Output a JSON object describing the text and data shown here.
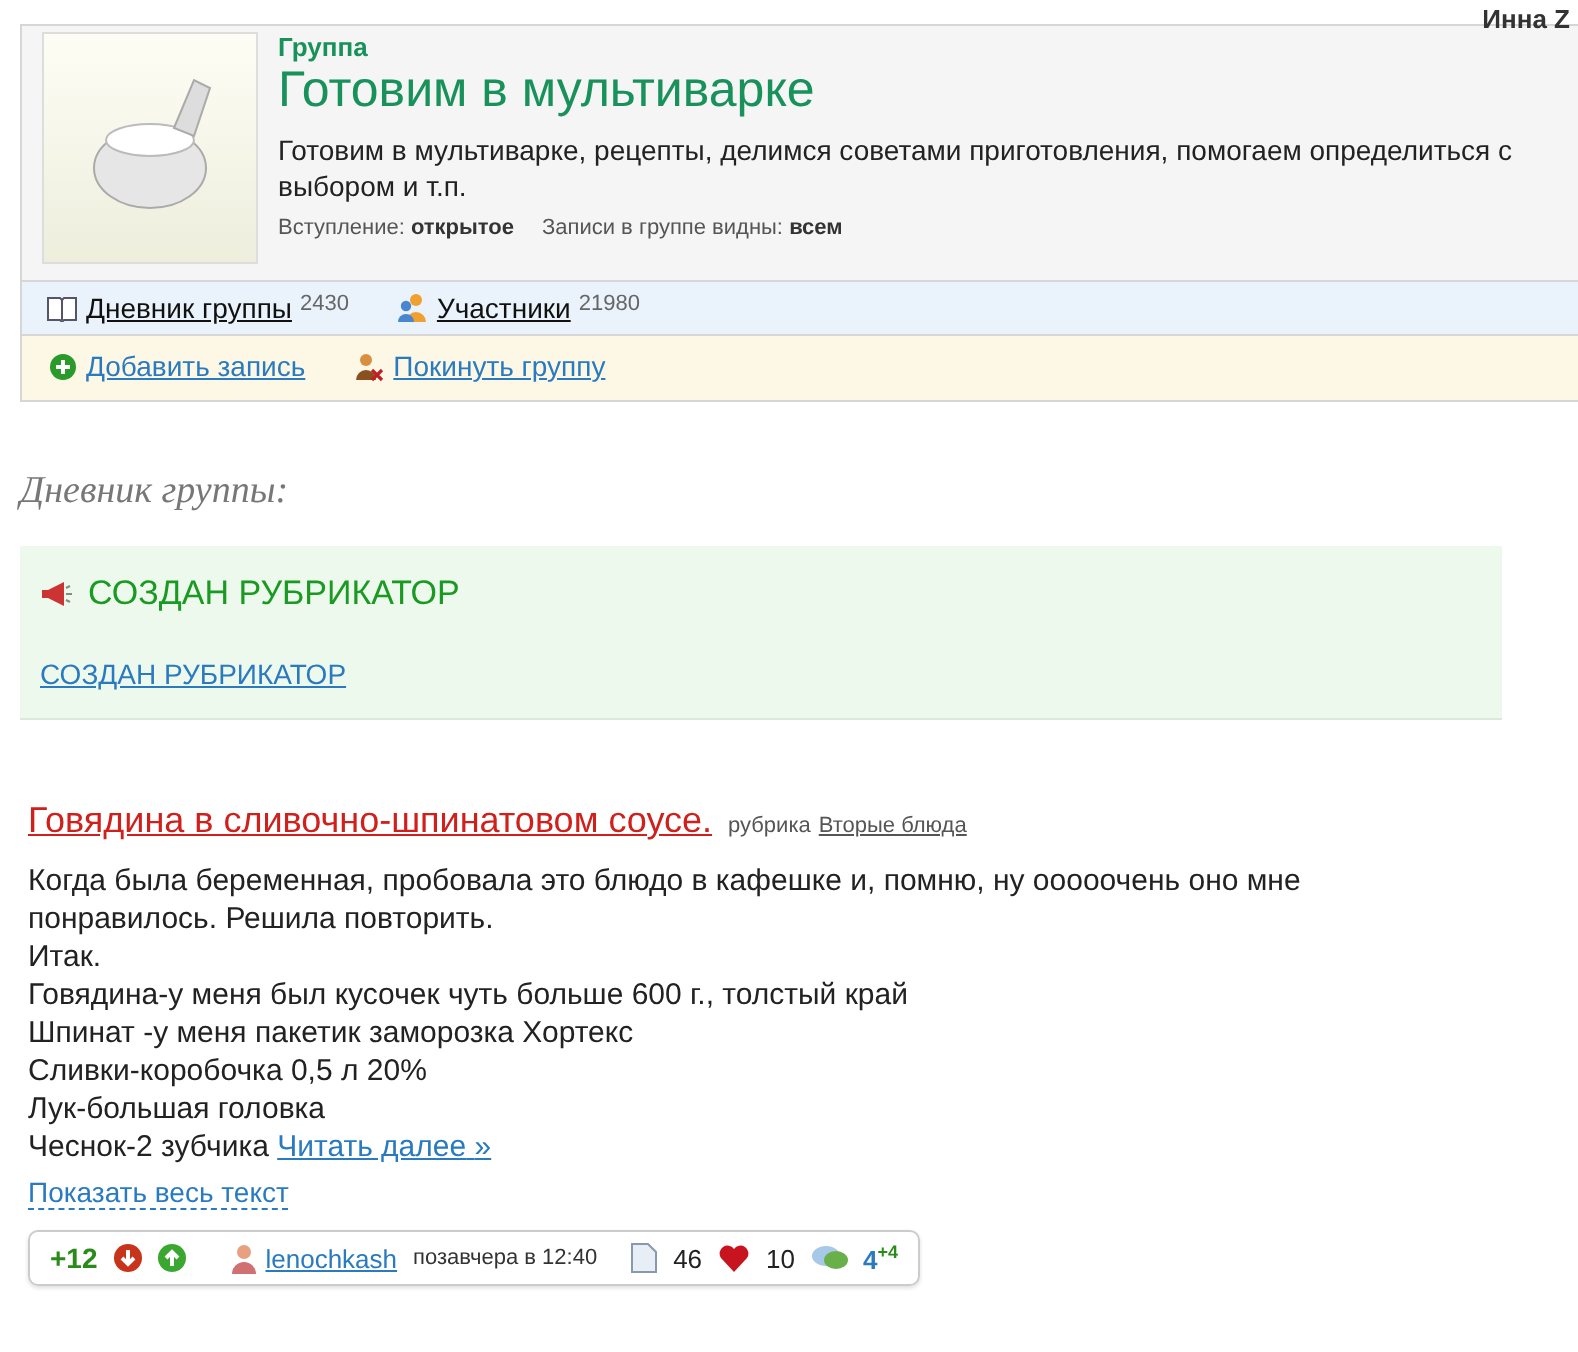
{
  "user": {
    "name": "Инна Z"
  },
  "group": {
    "label": "Группа",
    "title": "Готовим в мультиварке",
    "description": "Готовим в мультиварке, рецепты, делимся советами приготовления, помогаем определиться с выбором и т.п.",
    "meta": [
      {
        "label": "Вступление:",
        "value": "открытое"
      },
      {
        "label": "Записи в группе видны:",
        "value": "всем"
      }
    ]
  },
  "nav": [
    {
      "kind": "diary",
      "label": "Дневник группы",
      "count": "2430"
    },
    {
      "kind": "members",
      "label": "Участники",
      "count": "21980"
    }
  ],
  "actions": [
    {
      "kind": "add",
      "label": "Добавить запись"
    },
    {
      "kind": "leave",
      "label": "Покинуть группу"
    }
  ],
  "section_title": "Дневник группы:",
  "notice": {
    "title": "СОЗДАН РУБРИКАТОР",
    "link": "СОЗДАН РУБРИКАТОР"
  },
  "post": {
    "title": "Говядина в сливочно-шпинатовом соусе.",
    "rubric_label": "рубрика",
    "rubric": "Вторые блюда",
    "lines": [
      "Когда была беременная, пробовала это блюдо в кафешке и, помню, ну ооооочень оно мне понравилось. Решила повторить.",
      "Итак.",
      "Говядина-у меня был кусочек чуть больше 600 г., толстый край",
      "Шпинат -у меня пакетик заморозка Хортекс",
      "Сливки-коробочка 0,5 л 20%",
      "Лук-большая головка",
      "Чеснок-2 зубчика"
    ],
    "read_more": "Читать далее",
    "read_more_arrow": "»",
    "show_all": "Показать весь текст",
    "rating": "+12",
    "author": "lenochkash",
    "time": "позавчера в 12:40",
    "views": "46",
    "likes": "10",
    "comments": "4",
    "comments_new": "+4"
  }
}
